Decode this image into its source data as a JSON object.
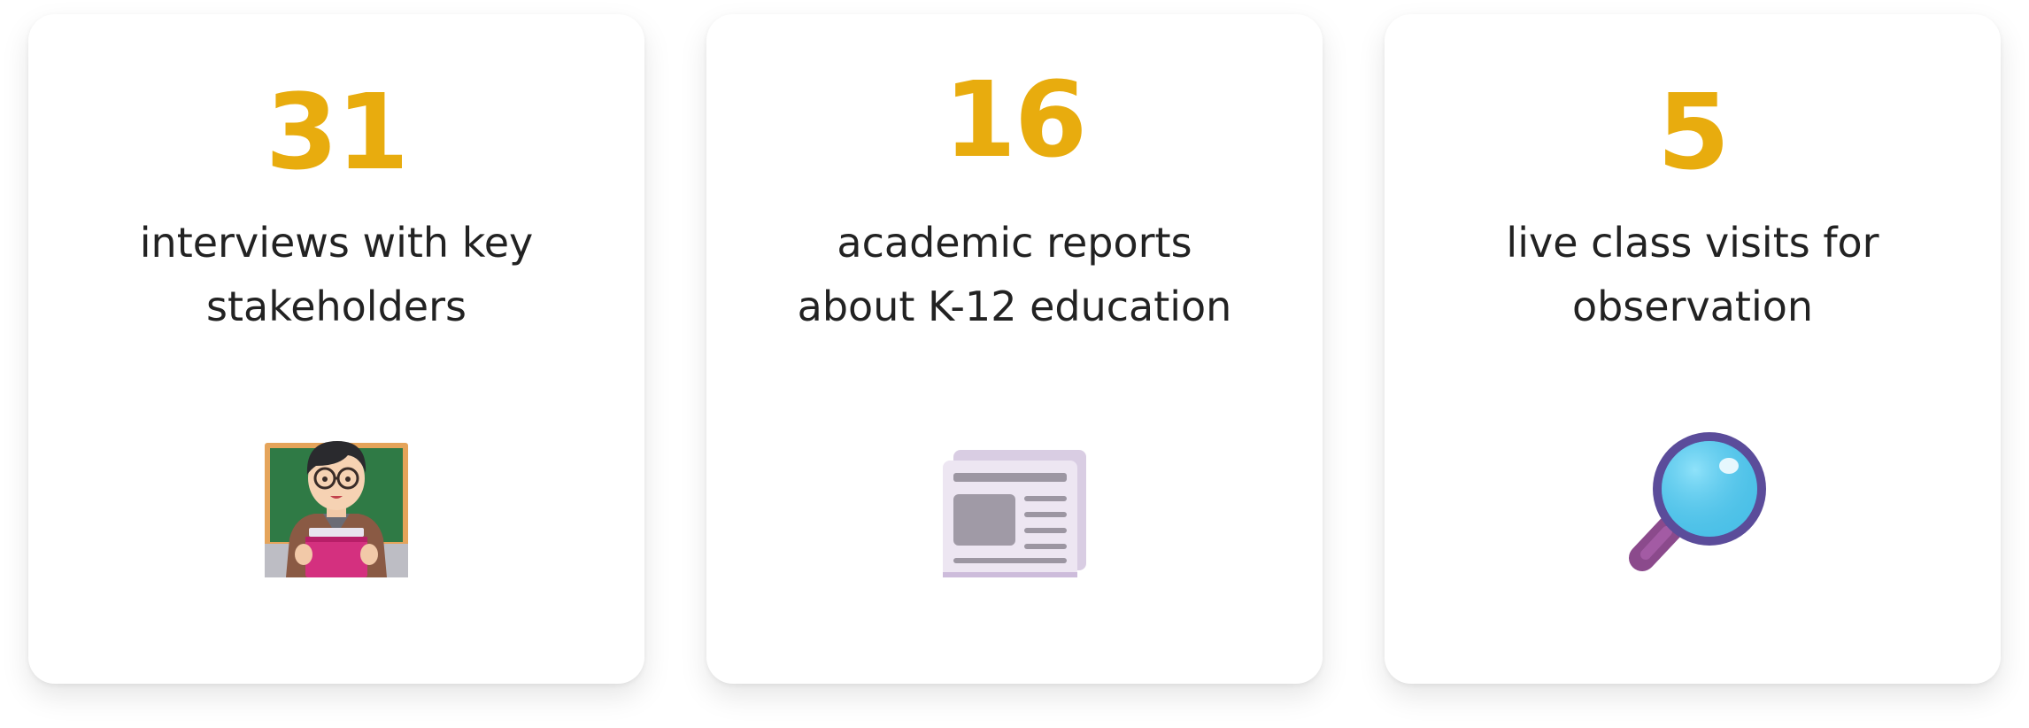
{
  "colors": {
    "accent": "#E8AC0E",
    "text": "#222222",
    "card_bg": "#FFFFFF"
  },
  "stats": [
    {
      "number": "31",
      "description_lines": [
        "interviews with key",
        "stakeholders"
      ],
      "icon": "teacher-icon"
    },
    {
      "number": "16",
      "description_lines": [
        "academic reports",
        "about K-12 education"
      ],
      "icon": "newspaper-icon"
    },
    {
      "number": "5",
      "description_lines": [
        "live class visits for",
        "observation"
      ],
      "icon": "magnifying-glass-icon"
    }
  ]
}
